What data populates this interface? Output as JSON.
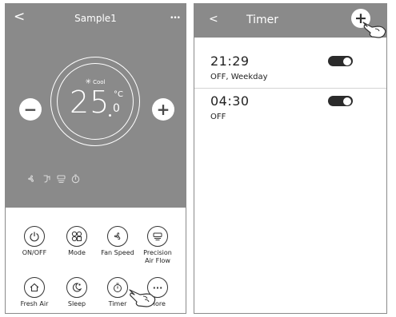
{
  "left_screen": {
    "header": {
      "back_label": "<",
      "title": "Sample1",
      "more_label": "•••"
    },
    "dial": {
      "mode_icon": "✳",
      "mode_label": "Cool",
      "temp_integer": "25",
      "temp_unit": "°C",
      "temp_decimal": "0"
    },
    "minus_label": "−",
    "plus_label": "+",
    "status_icons": [
      "fan-icon",
      "swing-icon",
      "airflow-icon",
      "timer-icon"
    ],
    "functions": {
      "on_off": "ON/OFF",
      "mode": "Mode",
      "fan_speed": "Fan Speed",
      "precision_1": "Precision",
      "precision_2": "Air Flow",
      "fresh_air": "Fresh Air",
      "sleep": "Sleep",
      "timer": "Timer",
      "more": "More"
    }
  },
  "right_screen": {
    "header": {
      "back_label": "<",
      "title": "Timer",
      "add_label": "+"
    },
    "timers": [
      {
        "time": "21:29",
        "repeat": "OFF, Weekday",
        "enabled": true
      },
      {
        "time": "04:30",
        "repeat": "OFF",
        "enabled": true
      }
    ]
  },
  "colors": {
    "panel_gray": "#8a8a8a",
    "toggle_on": "#2b2b2b",
    "white": "#ffffff"
  }
}
